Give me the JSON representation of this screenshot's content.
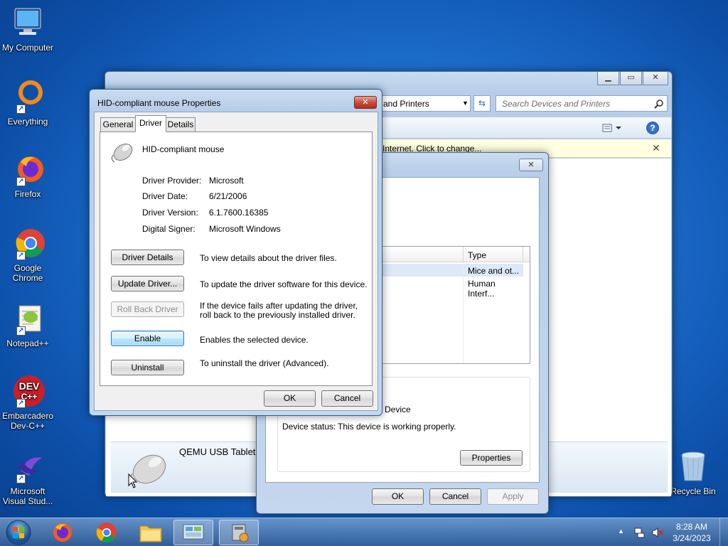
{
  "desktop": {
    "icons": [
      {
        "label": "My Computer"
      },
      {
        "label": "Everything"
      },
      {
        "label": "Firefox"
      },
      {
        "label": "Google Chrome"
      },
      {
        "label": "Notepad++"
      },
      {
        "label": "Embarcadero Dev-C++"
      },
      {
        "label": "Microsoft Visual Stud..."
      },
      {
        "label": "Recycle Bin"
      }
    ]
  },
  "explorer": {
    "breadcrumb_tail": "and Printers",
    "search_placeholder": "Search Devices and Printers",
    "info_bar": "Internet. Click to change...",
    "device_name": "QEMU USB Tablet"
  },
  "device_props": {
    "list_header_type": "Type",
    "rows": [
      {
        "type": "Mice and ot..."
      },
      {
        "type": "Human Interf..."
      }
    ],
    "device_label_tail": "Device",
    "status_label": "Device status:",
    "status_value": "This device is working properly.",
    "properties_button": "Properties",
    "ok": "OK",
    "cancel": "Cancel",
    "apply": "Apply"
  },
  "dialog": {
    "title": "HID-compliant mouse Properties",
    "tabs": [
      "General",
      "Driver",
      "Details"
    ],
    "device_name": "HID-compliant mouse",
    "fields": [
      {
        "label": "Driver Provider:",
        "value": "Microsoft"
      },
      {
        "label": "Driver Date:",
        "value": "6/21/2006"
      },
      {
        "label": "Driver Version:",
        "value": "6.1.7600.16385"
      },
      {
        "label": "Digital Signer:",
        "value": "Microsoft Windows"
      }
    ],
    "actions": [
      {
        "button": "Driver Details",
        "desc": "To view details about the driver files."
      },
      {
        "button": "Update Driver...",
        "desc": "To update the driver software for this device."
      },
      {
        "button": "Roll Back Driver",
        "desc": "If the device fails after updating the driver, roll back to the previously installed driver."
      },
      {
        "button": "Enable",
        "desc": "Enables the selected device."
      },
      {
        "button": "Uninstall",
        "desc": "To uninstall the driver (Advanced)."
      }
    ],
    "ok": "OK",
    "cancel": "Cancel"
  },
  "taskbar": {
    "time": "8:28 AM",
    "date": "3/24/2023"
  },
  "colors": {
    "desktop": "#1d6fcd",
    "info_bar": "#ffffe1",
    "selection": "#dde9f7"
  },
  "icons": [
    "computer-icon",
    "everything-icon",
    "firefox-icon",
    "chrome-icon",
    "notepadpp-icon",
    "devcpp-icon",
    "visual-studio-icon",
    "recycle-bin-icon",
    "mouse-icon",
    "windows-orb-icon"
  ]
}
